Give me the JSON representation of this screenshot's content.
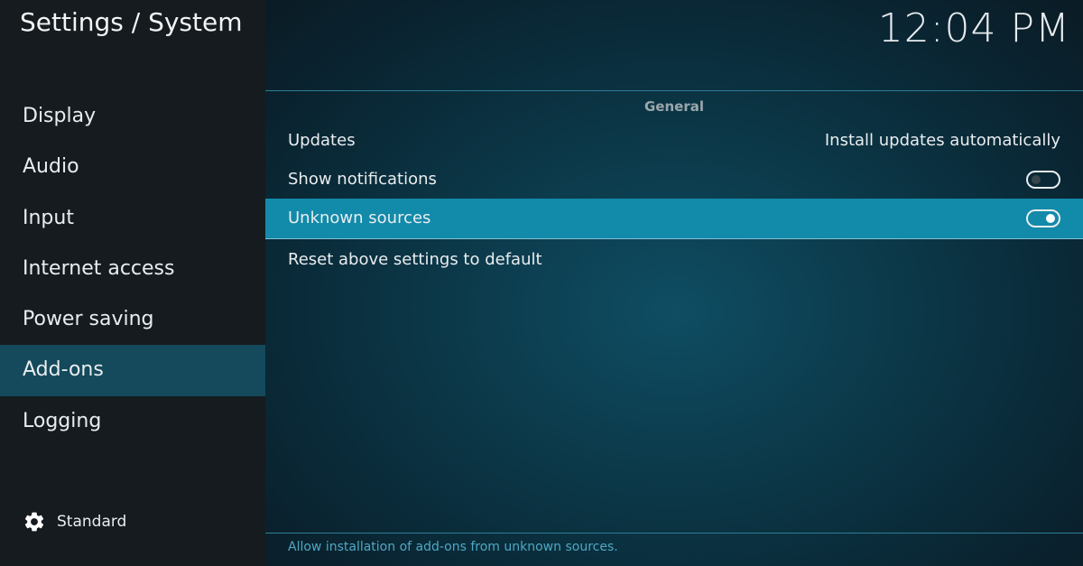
{
  "header": {
    "title": "Settings / System",
    "clock": "12:04 PM"
  },
  "sidebar": {
    "items": [
      {
        "label": "Display"
      },
      {
        "label": "Audio"
      },
      {
        "label": "Input"
      },
      {
        "label": "Internet access"
      },
      {
        "label": "Power saving"
      },
      {
        "label": "Add-ons",
        "active": true
      },
      {
        "label": "Logging"
      }
    ],
    "settings_level": {
      "icon": "gear-icon",
      "label": "Standard"
    }
  },
  "main": {
    "section_title": "General",
    "settings": [
      {
        "label": "Updates",
        "value": "Install updates automatically"
      },
      {
        "label": "Show notifications",
        "toggle": "off"
      },
      {
        "label": "Unknown sources",
        "toggle": "on",
        "selected": true
      },
      {
        "label": "Reset above settings to default"
      }
    ],
    "description": "Allow installation of add-ons from unknown sources."
  },
  "colors": {
    "sidebar_bg": "#151b1f",
    "active_item_bg": "#144a5b",
    "selected_row_bg": "#128aa9",
    "description_text": "#4ea8c4"
  }
}
